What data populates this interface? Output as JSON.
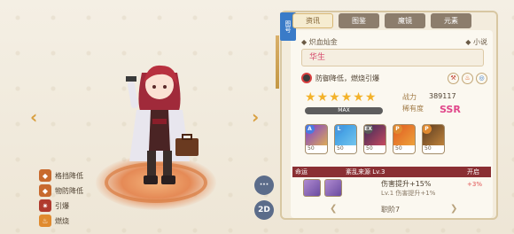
{
  "tabs": [
    {
      "label": "资讯",
      "active": true
    },
    {
      "label": "图鉴",
      "active": false
    },
    {
      "label": "魔镜",
      "active": false
    },
    {
      "label": "元素",
      "active": false
    }
  ],
  "ribbon_label": "图号",
  "title_left": "◆ 炽血灿金",
  "title_right": "◆ 小说",
  "character_name": "华生",
  "trait_text": "防御降低，燃烧引爆",
  "max_label": "MAX",
  "stars_count": 6,
  "stats": {
    "power_label": "战力",
    "power_value": "389117",
    "rarity_label": "稀有度",
    "rarity_value": "SSR"
  },
  "skills": [
    {
      "badge": "A",
      "badge_color": "#4a7be0",
      "level": "50",
      "colors": [
        "#7a3bd0",
        "#f0c040"
      ]
    },
    {
      "badge": "L",
      "badge_color": "#4a9be0",
      "level": "50",
      "colors": [
        "#3090e0",
        "#80d0f0"
      ]
    },
    {
      "badge": "EX",
      "badge_color": "#5a5a5a",
      "level": "50",
      "colors": [
        "#3a2a5a",
        "#e05060"
      ]
    },
    {
      "badge": "P",
      "badge_color": "#e08a30",
      "level": "50",
      "colors": [
        "#e05a20",
        "#f0b040"
      ]
    },
    {
      "badge": "P",
      "badge_color": "#e08a30",
      "level": "50",
      "colors": [
        "#5a3a20",
        "#d09040"
      ]
    }
  ],
  "artifact": {
    "left_label": "命运",
    "name": "紊乱来源 Lv.3",
    "status": "开启",
    "effect_title": "伤害提升+15%",
    "effect_sub": "Lv.1 伤害提升+1%",
    "effect_pct": "+3%"
  },
  "rank_label": "职阶7",
  "skill_tags": [
    {
      "label": "格挡降低",
      "color": "#c86a2e",
      "glyph": "◆"
    },
    {
      "label": "物防降低",
      "color": "#c86a2e",
      "glyph": "◆"
    },
    {
      "label": "引爆",
      "color": "#b03a2e",
      "glyph": "✷"
    },
    {
      "label": "燃烧",
      "color": "#e08a2e",
      "glyph": "♨"
    }
  ],
  "buttons": {
    "chat": "···",
    "mode": "2D"
  },
  "nav": {
    "left": "‹",
    "right": "›"
  }
}
